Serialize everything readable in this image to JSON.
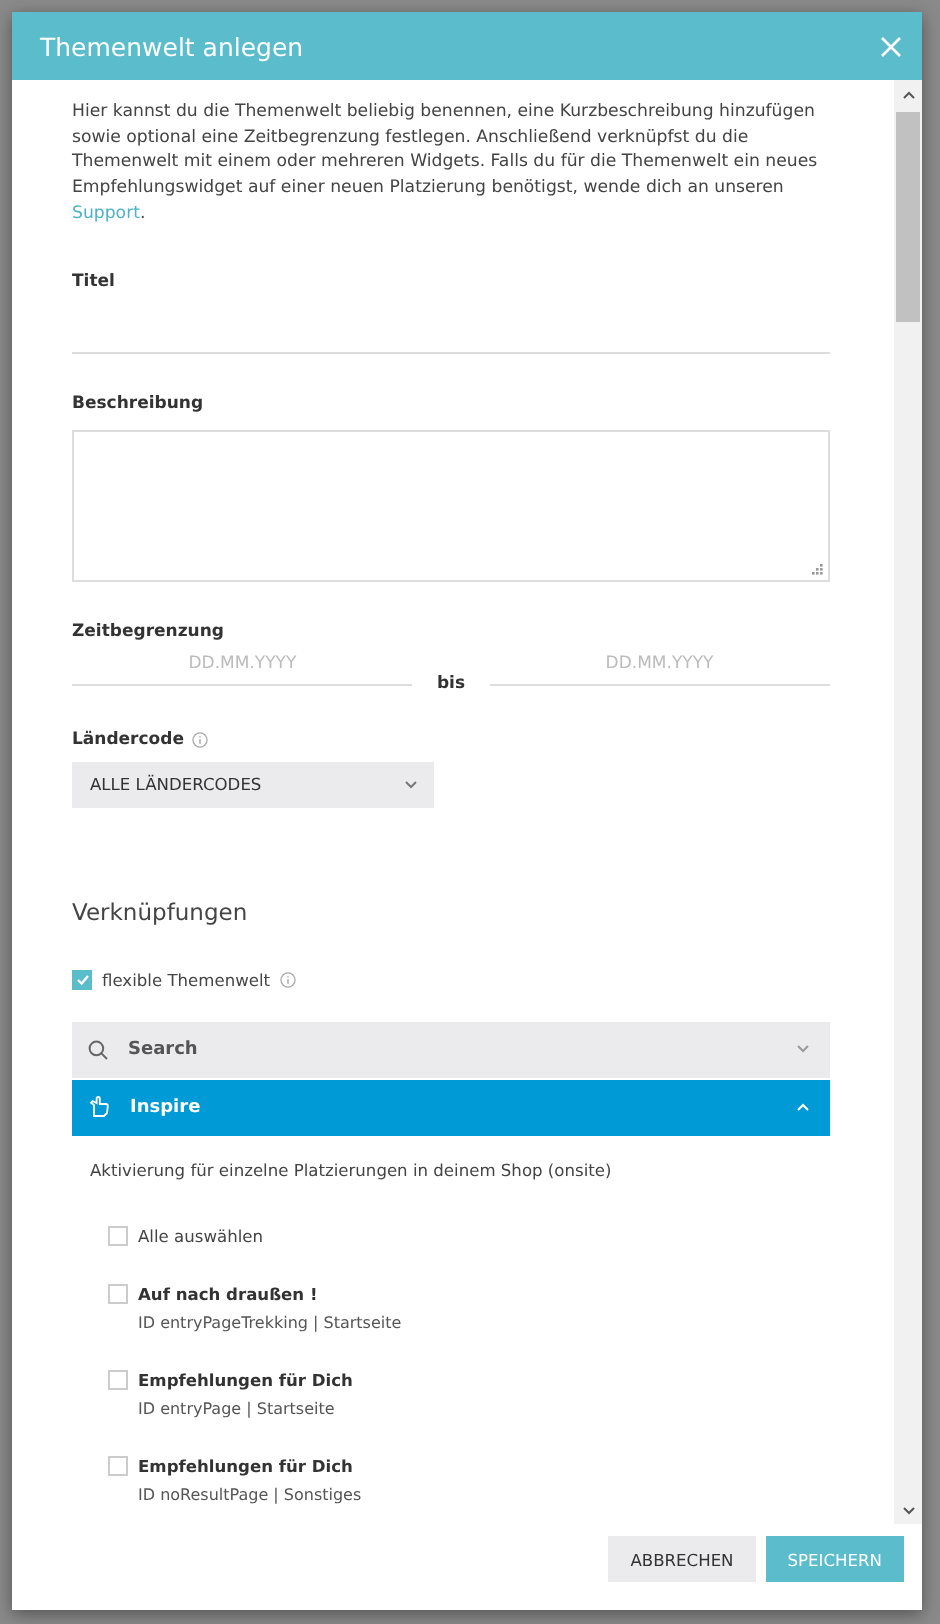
{
  "dialog": {
    "title": "Themenwelt anlegen"
  },
  "intro": {
    "text": "Hier kannst du die Themenwelt beliebig benennen, eine Kurzbeschreibung hinzufügen sowie optional eine Zeitbegrenzung festlegen. Anschließend verknüpfst du die Themenwelt mit einem oder mehreren Widgets. Falls du für die Themenwelt ein neues Empfehlungswidget auf einer neuen Platzierung benötigst, wende dich an unseren ",
    "link": "Support",
    "after": "."
  },
  "title_field": {
    "label": "Titel"
  },
  "description_field": {
    "label": "Beschreibung"
  },
  "time_limit": {
    "label": "Zeitbegrenzung",
    "from_placeholder": "DD.MM.YYYY",
    "separator": "bis",
    "to_placeholder": "DD.MM.YYYY"
  },
  "country_code": {
    "label": "Ländercode",
    "value": "ALLE LÄNDERCODES"
  },
  "links_heading": "Verknüpfungen",
  "flexible": {
    "label": "flexible Themenwelt",
    "checked": true
  },
  "accordions": [
    {
      "kind": "search",
      "label": "Search",
      "expanded": false
    },
    {
      "kind": "inspire",
      "label": "Inspire",
      "expanded": true
    }
  ],
  "inspire_panel": {
    "text": "Aktivierung für einzelne Platzierungen in deinem Shop (onsite)",
    "select_all": {
      "label": "Alle auswählen",
      "checked": false
    },
    "placements": [
      {
        "name": "Auf nach draußen !",
        "meta": "ID entryPageTrekking | Startseite",
        "checked": false
      },
      {
        "name": "Empfehlungen für Dich",
        "meta": "ID entryPage | Startseite",
        "checked": false
      },
      {
        "name": "Empfehlungen für Dich",
        "meta": "ID noResultPage | Sonstiges",
        "checked": false
      }
    ]
  },
  "buttons": [
    {
      "kind": "secondary",
      "label": "ABBRECHEN"
    },
    {
      "kind": "primary",
      "label": "SPEICHERN"
    }
  ]
}
